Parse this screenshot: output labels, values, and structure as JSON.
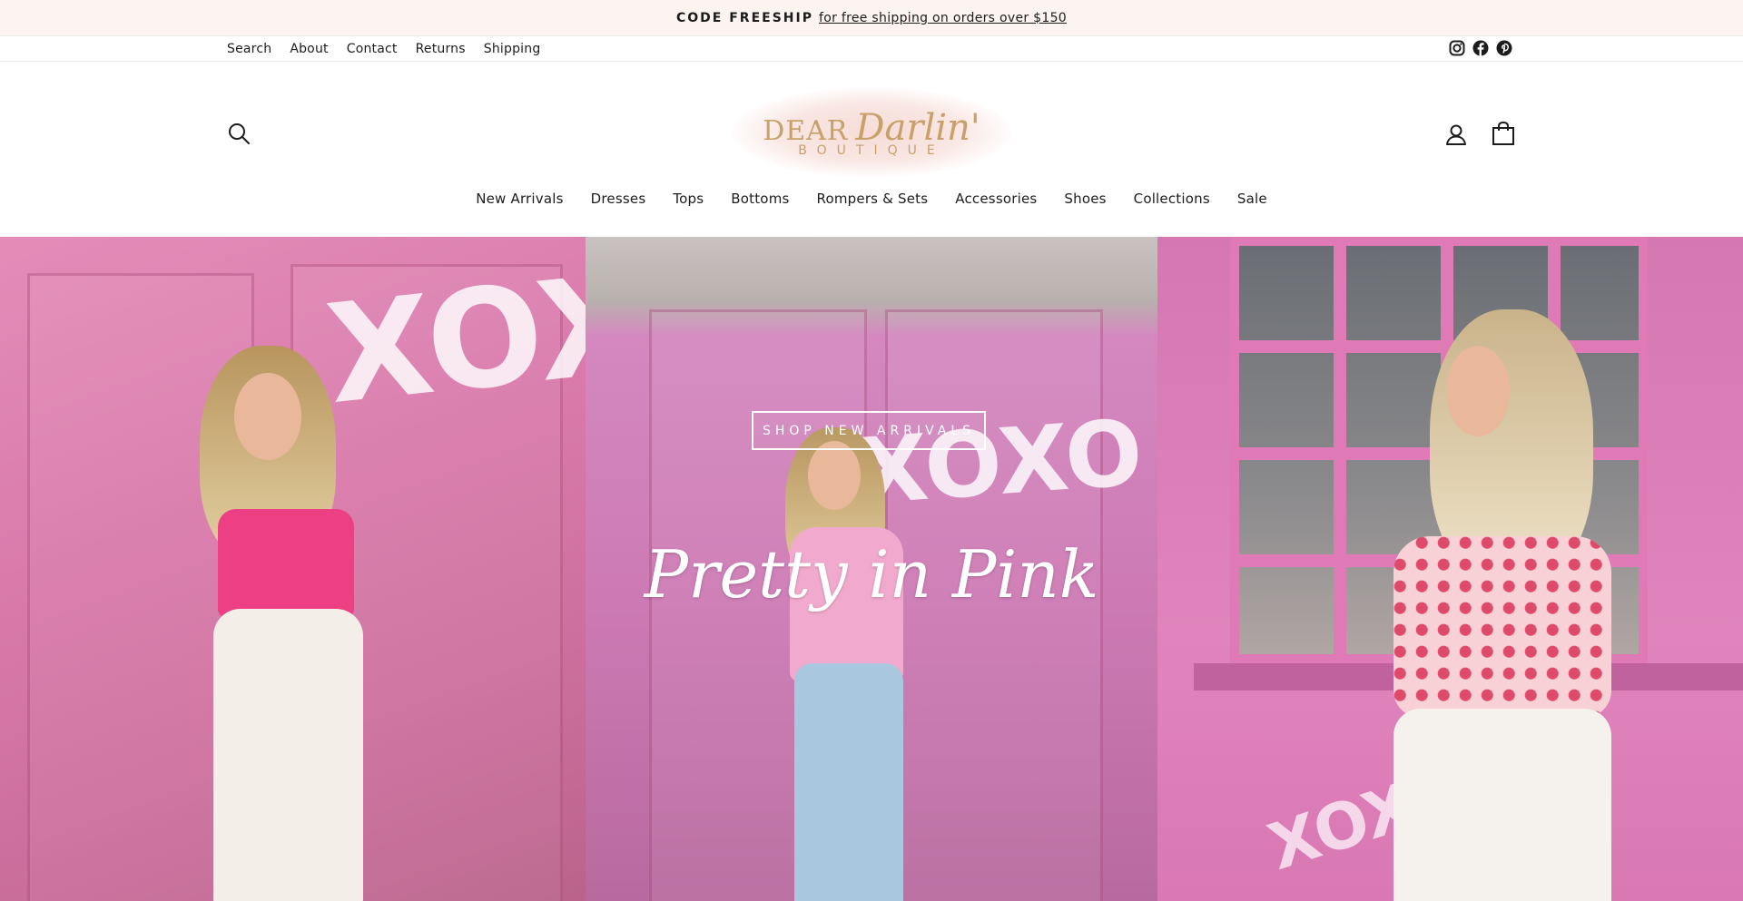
{
  "announcement": {
    "code": "CODE FREESHIP",
    "message": "for free shipping on orders over $150"
  },
  "utility_nav": {
    "links": [
      "Search",
      "About",
      "Contact",
      "Returns",
      "Shipping"
    ],
    "social_icons": [
      "instagram-icon",
      "facebook-icon",
      "pinterest-icon"
    ]
  },
  "header": {
    "logo": {
      "line1_a": "DEAR",
      "line1_b": "Darlin'",
      "line2": "BOUTIQUE"
    },
    "icons": [
      "search-icon",
      "account-icon",
      "cart-icon"
    ]
  },
  "main_nav": {
    "items": [
      "New Arrivals",
      "Dresses",
      "Tops",
      "Bottoms",
      "Rompers & Sets",
      "Accessories",
      "Shoes",
      "Collections",
      "Sale"
    ]
  },
  "hero": {
    "title": "Pretty in Pink",
    "cta_label": "SHOP NEW ARRIVALS",
    "graffiti": {
      "p1": "XOXO",
      "p2": "XOXO",
      "p3": "XOXO"
    }
  },
  "colors": {
    "announcement_bg": "#fdf3f1",
    "logo_gold": "#c7a06a",
    "hero_pink": "#d97aab"
  }
}
